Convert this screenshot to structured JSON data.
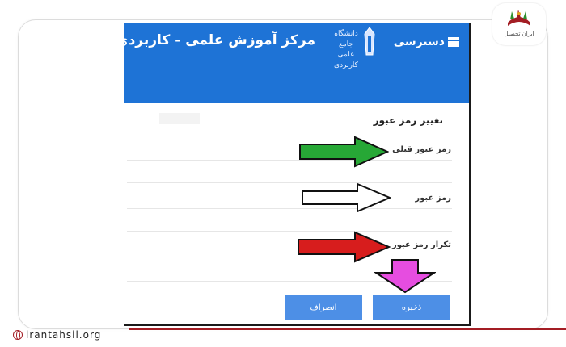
{
  "header": {
    "menu_label": "دسترسی",
    "app_title": "مرکز آموزش علمی - کاربردی",
    "logo_text_line1": "دانشگاه جامع",
    "logo_text_line2": "علمی کاربردی"
  },
  "form": {
    "title": "تغییر رمز عبور",
    "fields": [
      {
        "label": "رمز عبور قبلی",
        "value": ""
      },
      {
        "label": "رمز عبور",
        "value": ""
      },
      {
        "label": "تکرار رمز عبور",
        "value": ""
      }
    ],
    "save_label": "ذخیره",
    "cancel_label": "انصراف"
  },
  "annotations": {
    "arrow_colors": [
      "#27a836",
      "#ffffff",
      "#d71d1d",
      "#e64de0"
    ]
  },
  "branding": {
    "badge_text": "ایران تحصیل",
    "site_url": "irantahsil.org"
  },
  "colors": {
    "appbar": "#1e73d6",
    "button": "#4d8fe6",
    "frame_accent": "#a31d24"
  }
}
